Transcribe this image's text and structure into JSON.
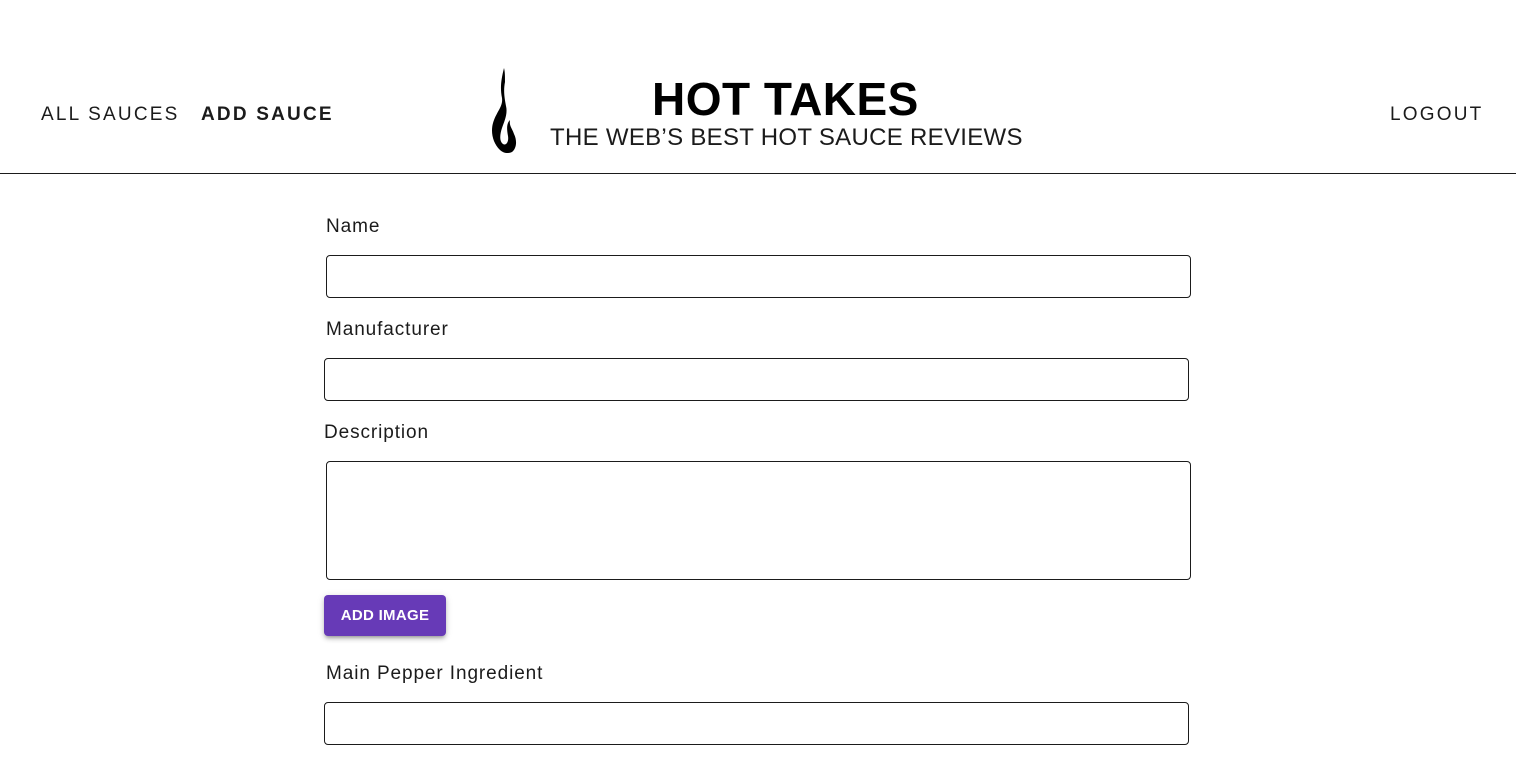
{
  "colors": {
    "accent": "#673ab7",
    "text": "#1b1b1b",
    "background": "#ffffff"
  },
  "nav": {
    "all_sauces": "ALL SAUCES",
    "add_sauce": "ADD SAUCE",
    "logout": "LOGOUT"
  },
  "brand": {
    "logo_icon": "flame-icon",
    "title": "HOT TAKES",
    "subtitle": "THE WEB’S BEST HOT SAUCE REVIEWS"
  },
  "form": {
    "name": {
      "label": "Name",
      "value": ""
    },
    "manufacturer": {
      "label": "Manufacturer",
      "value": ""
    },
    "description": {
      "label": "Description",
      "value": ""
    },
    "add_image_label": "ADD IMAGE",
    "main_pepper": {
      "label": "Main Pepper Ingredient",
      "value": ""
    }
  }
}
